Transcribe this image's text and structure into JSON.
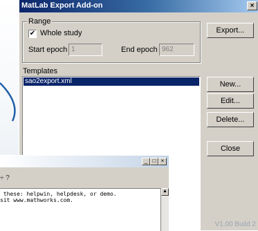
{
  "dialog": {
    "title": "MatLab Export Add-on",
    "close_glyph": "×",
    "range": {
      "legend": "Range",
      "whole_study_label": "Whole study",
      "whole_study_checked_glyph": "✔",
      "start_epoch_label": "Start epoch",
      "start_epoch_value": "1",
      "end_epoch_label": "End epoch",
      "end_epoch_value": "962"
    },
    "templates_label": "Templates",
    "templates": [
      "sao2export.xml"
    ],
    "buttons": {
      "export": "Export...",
      "new": "New...",
      "edit": "Edit...",
      "delete": "Delete...",
      "close": "Close"
    },
    "version": "V1.00 Build 2"
  },
  "background_window": {
    "controls": [
      "_",
      "□",
      "×"
    ],
    "toolbar_text": "÷  ?",
    "console_lines": [
      " these: helpwin, helpdesk, or demo.",
      "sit www.mathworks.com."
    ]
  }
}
